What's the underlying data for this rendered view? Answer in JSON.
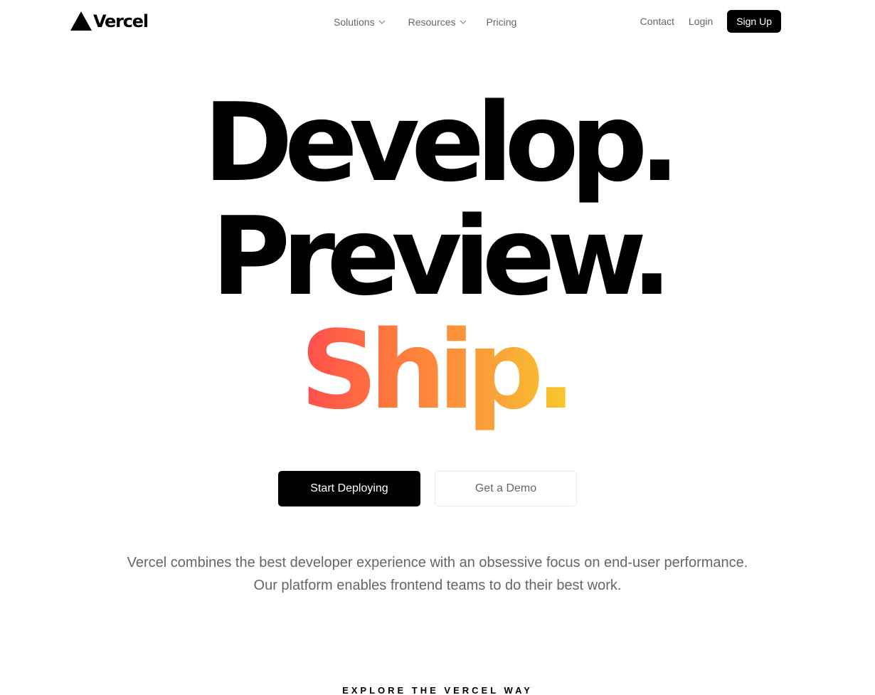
{
  "header": {
    "logo_text": "Vercel",
    "nav": {
      "solutions": "Solutions",
      "resources": "Resources",
      "pricing": "Pricing"
    },
    "contact": "Contact",
    "login": "Login",
    "signup": "Sign Up"
  },
  "hero": {
    "line1": "Develop.",
    "line2": "Preview.",
    "line3": "Ship.",
    "ship_gradient": [
      "#ff4d4d",
      "#f9cb28"
    ]
  },
  "cta": {
    "primary": "Start Deploying",
    "secondary": "Get a Demo"
  },
  "description": {
    "line1": "Vercel combines the best developer experience with an obsessive focus on end-user performance.",
    "line2": "Our platform enables frontend teams to do their best work."
  },
  "explore": "EXPLORE THE VERCEL WAY",
  "colors": {
    "accent": "#000000",
    "muted_text": "#666666"
  }
}
